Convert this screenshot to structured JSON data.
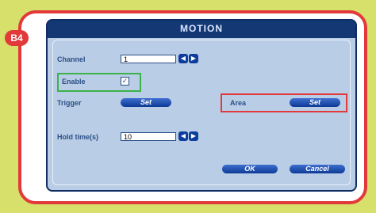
{
  "badge": {
    "label": "B4"
  },
  "dialog": {
    "title": "MOTION",
    "channel": {
      "label": "Channel",
      "value": "1"
    },
    "enable": {
      "label": "Enable",
      "checked": true
    },
    "trigger": {
      "label": "Trigger",
      "button": "Set"
    },
    "area": {
      "label": "Area",
      "button": "Set"
    },
    "hold_time": {
      "label": "Hold time(s)",
      "value": "10"
    },
    "buttons": {
      "ok": "OK",
      "cancel": "Cancel"
    }
  },
  "icons": {
    "left": "arrow-left-icon",
    "right": "arrow-right-icon",
    "check": "checkmark-icon"
  },
  "colors": {
    "background": "#d6e06a",
    "frame_border": "#e23a3a",
    "dialog_header": "#143874",
    "dialog_body": "#b9cde6",
    "button_blue": "#0c3a95",
    "enable_highlight": "#3cb34a",
    "area_highlight": "#e23a3a"
  }
}
